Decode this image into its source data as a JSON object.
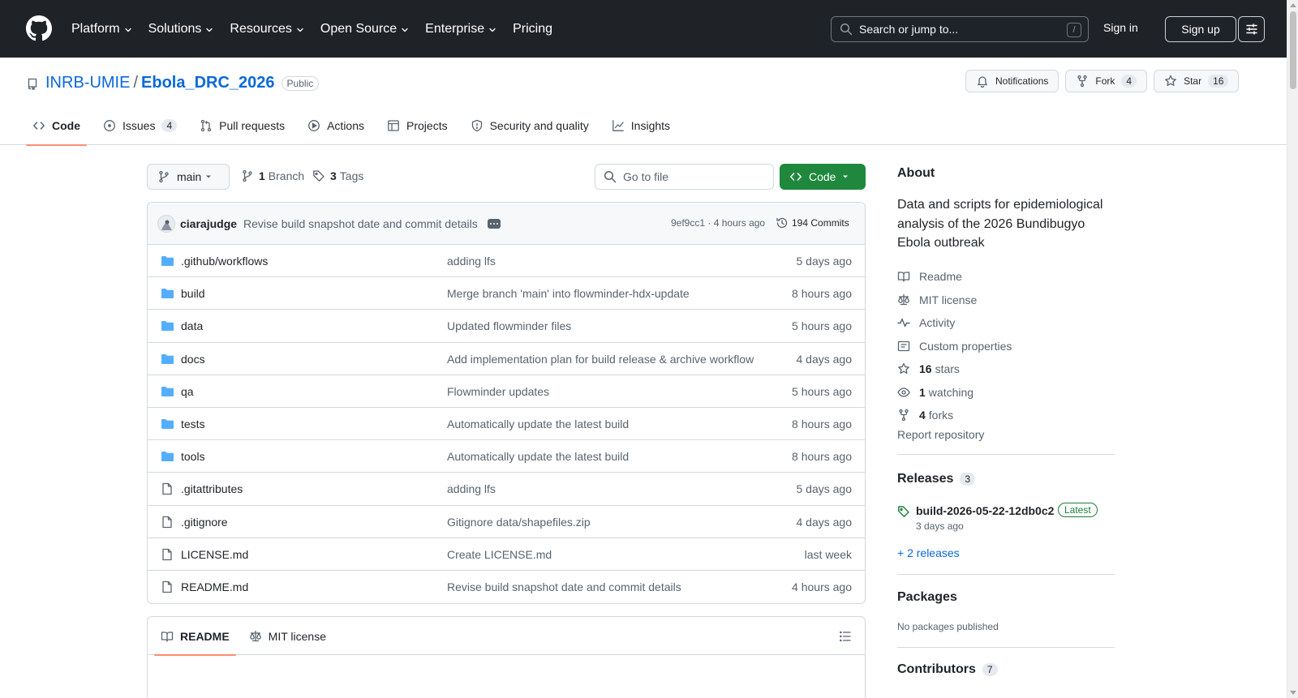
{
  "header": {
    "nav": [
      {
        "label": "Platform",
        "has_menu": true
      },
      {
        "label": "Solutions",
        "has_menu": true
      },
      {
        "label": "Resources",
        "has_menu": true
      },
      {
        "label": "Open Source",
        "has_menu": true
      },
      {
        "label": "Enterprise",
        "has_menu": true
      },
      {
        "label": "Pricing",
        "has_menu": false
      }
    ],
    "search_placeholder": "Search or jump to...",
    "search_shortcut": "/",
    "sign_in": "Sign in",
    "sign_up": "Sign up"
  },
  "repo": {
    "owner": "INRB-UMIE",
    "separator": "/",
    "name": "Ebola_DRC_2026",
    "visibility": "Public",
    "notifications_label": "Notifications",
    "fork_label": "Fork",
    "fork_count": "4",
    "star_label": "Star",
    "star_count": "16",
    "tabs": [
      {
        "label": "Code",
        "icon": "code-icon",
        "active": true,
        "count": ""
      },
      {
        "label": "Issues",
        "icon": "issue-opened-icon",
        "active": false,
        "count": "4"
      },
      {
        "label": "Pull requests",
        "icon": "git-pull-request-icon",
        "active": false,
        "count": ""
      },
      {
        "label": "Actions",
        "icon": "play-icon",
        "active": false,
        "count": ""
      },
      {
        "label": "Projects",
        "icon": "table-icon",
        "active": false,
        "count": ""
      },
      {
        "label": "Security and quality",
        "icon": "shield-icon",
        "active": false,
        "count": ""
      },
      {
        "label": "Insights",
        "icon": "graph-icon",
        "active": false,
        "count": ""
      }
    ]
  },
  "toolbar": {
    "branch": "main",
    "branch_count": "1",
    "branch_label": "Branch",
    "tag_count": "3",
    "tag_label": "Tags",
    "goto_placeholder": "Go to file",
    "code_button": "Code"
  },
  "latest_commit": {
    "author": "ciarajudge",
    "message": "Revise build snapshot date and commit details",
    "sha": "9ef9cc1",
    "meta_sep": "·",
    "time": "4 hours ago",
    "commits_label": "194 Commits"
  },
  "files": [
    {
      "name": ".github/workflows",
      "type": "dir",
      "commit": "adding lfs",
      "date": "5 days ago"
    },
    {
      "name": "build",
      "type": "dir",
      "commit": "Merge branch 'main' into flowminder-hdx-update",
      "date": "8 hours ago"
    },
    {
      "name": "data",
      "type": "dir",
      "commit": "Updated flowminder files",
      "date": "5 hours ago"
    },
    {
      "name": "docs",
      "type": "dir",
      "commit": "Add implementation plan for build release & archive workflow",
      "date": "4 days ago"
    },
    {
      "name": "qa",
      "type": "dir",
      "commit": "Flowminder updates",
      "date": "5 hours ago"
    },
    {
      "name": "tests",
      "type": "dir",
      "commit": "Automatically update the latest build",
      "date": "8 hours ago"
    },
    {
      "name": "tools",
      "type": "dir",
      "commit": "Automatically update the latest build",
      "date": "8 hours ago"
    },
    {
      "name": ".gitattributes",
      "type": "file",
      "commit": "adding lfs",
      "date": "5 days ago"
    },
    {
      "name": ".gitignore",
      "type": "file",
      "commit": "Gitignore data/shapefiles.zip",
      "date": "4 days ago"
    },
    {
      "name": "LICENSE.md",
      "type": "file",
      "commit": "Create LICENSE.md",
      "date": "last week"
    },
    {
      "name": "README.md",
      "type": "file",
      "commit": "Revise build snapshot date and commit details",
      "date": "4 hours ago"
    }
  ],
  "readme": {
    "tab_readme": "README",
    "tab_license": "MIT license"
  },
  "sidebar": {
    "about_title": "About",
    "description": "Data and scripts for epidemiological analysis of the 2026 Bundibugyo Ebola outbreak",
    "links": [
      {
        "icon": "book-icon",
        "bold": "",
        "label": "Readme"
      },
      {
        "icon": "law-icon",
        "bold": "",
        "label": "MIT license"
      },
      {
        "icon": "pulse-icon",
        "bold": "",
        "label": "Activity"
      },
      {
        "icon": "note-icon",
        "bold": "",
        "label": "Custom properties"
      },
      {
        "icon": "star-icon",
        "bold": "16",
        "label": "stars"
      },
      {
        "icon": "eye-icon",
        "bold": "1",
        "label": "watching"
      },
      {
        "icon": "repo-forked-icon",
        "bold": "4",
        "label": "forks"
      }
    ],
    "report": "Report repository",
    "releases_title": "Releases",
    "releases_count": "3",
    "release_name": "build-2026-05-22-12db0c2",
    "release_badge": "Latest",
    "release_date": "3 days ago",
    "more_releases": "+ 2 releases",
    "packages_title": "Packages",
    "no_packages": "No packages published",
    "contributors_title": "Contributors",
    "contributors_count": "7"
  },
  "colors": {
    "header_bg": "#1f2328",
    "link": "#0969da",
    "primary_button": "#1f883d",
    "tab_underline": "#fd8c73",
    "folder": "#54aeff",
    "latest_badge": "#1a7f37"
  }
}
